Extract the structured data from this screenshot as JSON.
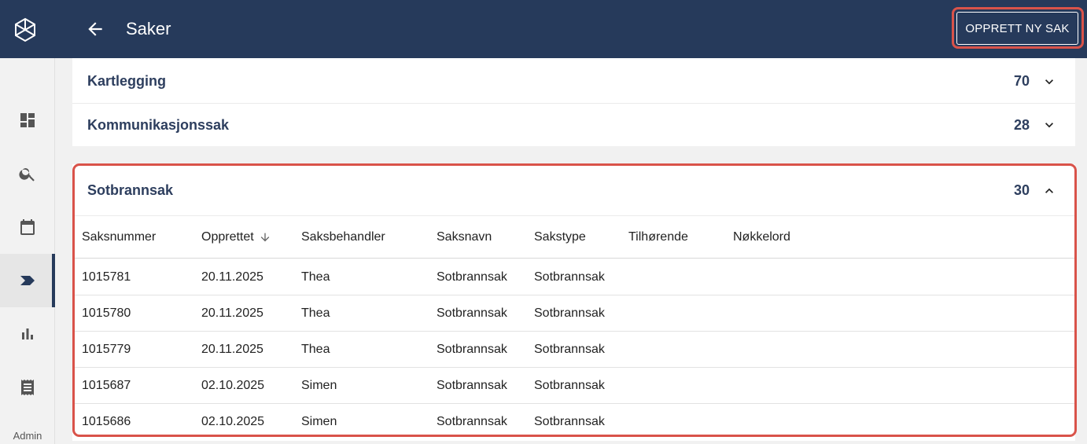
{
  "header": {
    "title": "Saker",
    "create_button": "OPPRETT NY SAK"
  },
  "sidebar": {
    "items": [
      {
        "name": "dashboard-icon"
      },
      {
        "name": "search-icon"
      },
      {
        "name": "calendar-icon"
      },
      {
        "name": "cases-icon",
        "active": true
      },
      {
        "name": "bar-chart-icon"
      },
      {
        "name": "receipt-icon"
      }
    ],
    "admin_label": "Admin"
  },
  "groups": [
    {
      "name": "Kartlegging",
      "count": "70",
      "expanded": false
    },
    {
      "name": "Kommunikasjonssak",
      "count": "28",
      "expanded": false
    }
  ],
  "expanded_group": {
    "name": "Sotbrannsak",
    "count": "30",
    "columns": [
      "Saksnummer",
      "Opprettet",
      "Saksbehandler",
      "Saksnavn",
      "Sakstype",
      "Tilhørende",
      "Nøkkelord"
    ],
    "sorted_column": "Opprettet",
    "rows": [
      {
        "saksnummer": "1015781",
        "opprettet": "20.11.2025",
        "saksbehandler": "Thea",
        "saksnavn": "Sotbrannsak",
        "sakstype": "Sotbrannsak"
      },
      {
        "saksnummer": "1015780",
        "opprettet": "20.11.2025",
        "saksbehandler": "Thea",
        "saksnavn": "Sotbrannsak",
        "sakstype": "Sotbrannsak"
      },
      {
        "saksnummer": "1015779",
        "opprettet": "20.11.2025",
        "saksbehandler": "Thea",
        "saksnavn": "Sotbrannsak",
        "sakstype": "Sotbrannsak"
      },
      {
        "saksnummer": "1015687",
        "opprettet": "02.10.2025",
        "saksbehandler": "Simen",
        "saksnavn": "Sotbrannsak",
        "sakstype": "Sotbrannsak"
      },
      {
        "saksnummer": "1015686",
        "opprettet": "02.10.2025",
        "saksbehandler": "Simen",
        "saksnavn": "Sotbrannsak",
        "sakstype": "Sotbrannsak"
      }
    ]
  },
  "colors": {
    "header_bg": "#263a5b",
    "highlight": "#d9534a",
    "group_text": "#2d3e5e"
  }
}
